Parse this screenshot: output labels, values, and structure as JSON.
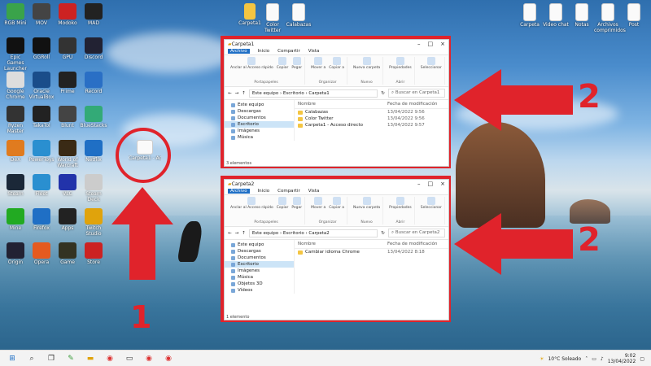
{
  "desktop_icons_left": [
    {
      "label": "RGB Mini"
    },
    {
      "label": "MOV"
    },
    {
      "label": "Modoko"
    },
    {
      "label": "MAD"
    },
    {
      "label": "Epic Games Launcher"
    },
    {
      "label": "GGRoll"
    },
    {
      "label": "GPU"
    },
    {
      "label": "Discord"
    },
    {
      "label": "Google Chrome"
    },
    {
      "label": "Oracle VirtualBox"
    },
    {
      "label": "Prime"
    },
    {
      "label": "Record"
    },
    {
      "label": "Ryzen Master"
    },
    {
      "label": "TakaTol"
    },
    {
      "label": "Blunt"
    },
    {
      "label": "BlueStacks"
    },
    {
      "label": "DeX"
    },
    {
      "label": "PowerToys"
    },
    {
      "label": "World of Warcraft"
    },
    {
      "label": "Netflix"
    },
    {
      "label": "Steam"
    },
    {
      "label": "Fleet"
    },
    {
      "label": "VLC"
    },
    {
      "label": "Steam Deck"
    },
    {
      "label": "Mine"
    },
    {
      "label": "Firefox"
    },
    {
      "label": "Apps"
    },
    {
      "label": "Twitch Studio"
    },
    {
      "label": "Origin"
    },
    {
      "label": "Opera"
    },
    {
      "label": "Game"
    },
    {
      "label": "Store"
    }
  ],
  "desktop_icons_top": [
    {
      "label": "Carpeta1"
    },
    {
      "label": "Color Twitter"
    },
    {
      "label": "Calabazas"
    }
  ],
  "desktop_icons_right": [
    {
      "label": "Carpeta"
    },
    {
      "label": "Video chat"
    },
    {
      "label": "Notas"
    },
    {
      "label": "Archivos comprimidos"
    },
    {
      "label": "Post"
    }
  ],
  "shortcut_icon": {
    "label": "Carpeta1 - Acceso directo"
  },
  "window1": {
    "title": "Carpeta1",
    "menus": [
      "Archivo",
      "Inicio",
      "Compartir",
      "Vista"
    ],
    "ribbon_groups": [
      {
        "name": "Portapapeles",
        "buttons": [
          "Anclar al Acceso rápido",
          "Copiar",
          "Pegar"
        ]
      },
      {
        "name": "Organizar",
        "buttons": [
          "Mover a",
          "Copiar a"
        ]
      },
      {
        "name": "Nuevo",
        "buttons": [
          "Nueva carpeta"
        ]
      },
      {
        "name": "Abrir",
        "buttons": [
          "Propiedades"
        ]
      },
      {
        "name": "",
        "buttons": [
          "Seleccionar"
        ]
      }
    ],
    "path": "Este equipo  ›  Escritorio  ›  Carpeta1",
    "search_placeholder": "Buscar en Carpeta1",
    "nav": [
      "Este equipo",
      "Descargas",
      "Documentos",
      "Escritorio",
      "Imágenes",
      "Música"
    ],
    "col_name": "Nombre",
    "col_date": "Fecha de modificación",
    "files": [
      {
        "name": "Calabazas",
        "date": "13/04/2022 9:56"
      },
      {
        "name": "Color Twitter",
        "date": "13/04/2022 9:56"
      },
      {
        "name": "Carpeta1 - Acceso directo",
        "date": "13/04/2022 9:57"
      }
    ],
    "status": "3 elementos"
  },
  "window2": {
    "title": "Carpeta2",
    "menus": [
      "Archivo",
      "Inicio",
      "Compartir",
      "Vista"
    ],
    "ribbon_groups": [
      {
        "name": "Portapapeles",
        "buttons": [
          "Anclar al Acceso rápido",
          "Copiar",
          "Pegar"
        ]
      },
      {
        "name": "Organizar",
        "buttons": [
          "Mover a",
          "Copiar a"
        ]
      },
      {
        "name": "Nuevo",
        "buttons": [
          "Nueva carpeta"
        ]
      },
      {
        "name": "Abrir",
        "buttons": [
          "Propiedades"
        ]
      },
      {
        "name": "",
        "buttons": [
          "Seleccionar"
        ]
      }
    ],
    "path": "Este equipo  ›  Escritorio  ›  Carpeta2",
    "search_placeholder": "Buscar en Carpeta2",
    "nav": [
      "Este equipo",
      "Descargas",
      "Documentos",
      "Escritorio",
      "Imágenes",
      "Música",
      "Objetos 3D",
      "Vídeos"
    ],
    "col_name": "Nombre",
    "col_date": "Fecha de modificación",
    "files": [
      {
        "name": "Cambiar idioma Chrome",
        "date": "13/04/2022 8:18"
      }
    ],
    "status": "1 elemento"
  },
  "annotations": {
    "num1": "1",
    "num2a": "2",
    "num2b": "2"
  },
  "taskbar": {
    "weather": "10°C  Soleado",
    "time": "9:02",
    "date": "13/04/2022"
  },
  "colors": {
    "annotation": "#e0232b",
    "accent": "#1f6fc5"
  }
}
